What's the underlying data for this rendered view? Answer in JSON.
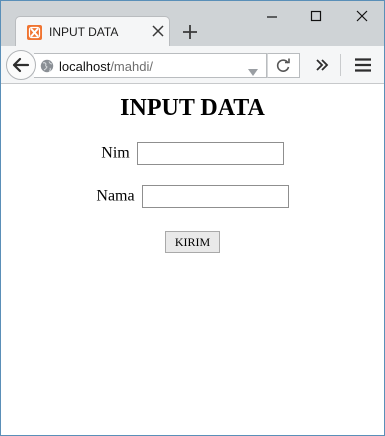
{
  "browser": {
    "tab": {
      "title": "INPUT DATA",
      "favicon": "xampp-icon"
    },
    "address": {
      "host": "localhost",
      "path": "/mahdi/"
    },
    "icons": {
      "back": "back-arrow-icon",
      "globe": "globe-icon",
      "reload": "reload-icon",
      "overflow": "chevrons-right-icon",
      "menu": "hamburger-menu-icon",
      "new_tab": "plus-icon",
      "tab_close": "close-icon",
      "minimize": "minimize-icon",
      "maximize": "maximize-icon",
      "close": "close-icon"
    },
    "colors": {
      "tabstrip": "#cfd3d6",
      "favicon": "#f07431",
      "window_border": "#5a8fb8"
    }
  },
  "page": {
    "heading": "INPUT DATA",
    "form": {
      "nim_label": "Nim",
      "nim_value": "",
      "nama_label": "Nama",
      "nama_value": "",
      "submit_label": "KIRIM"
    }
  }
}
